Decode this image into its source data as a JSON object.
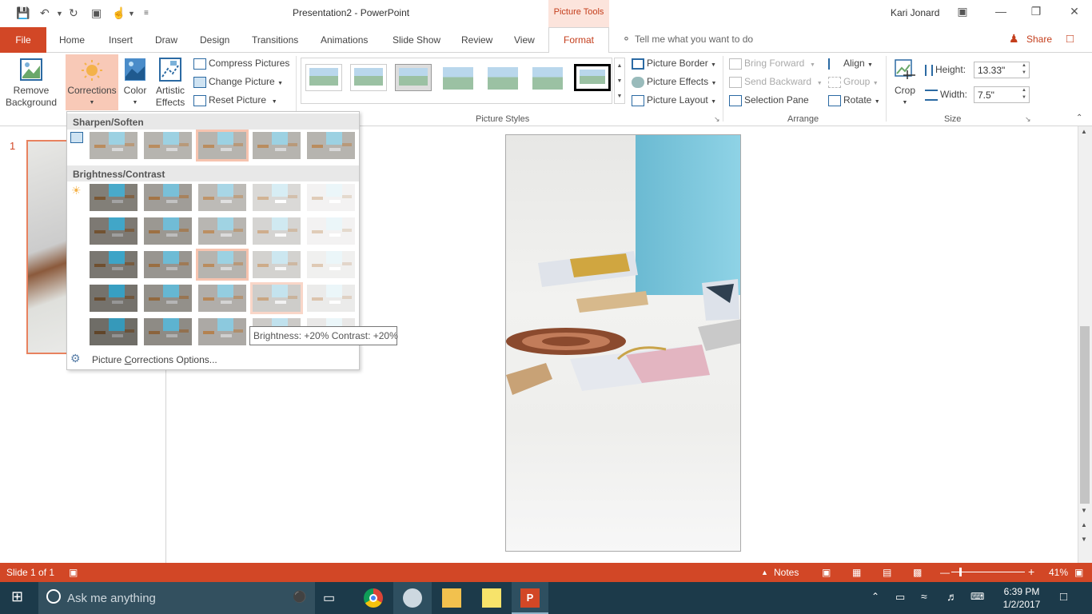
{
  "titlebar": {
    "doc_title": "Presentation2 - PowerPoint",
    "context_tab": "Picture Tools",
    "user": "Kari Jonard"
  },
  "tabs": {
    "file": "File",
    "items": [
      "Home",
      "Insert",
      "Draw",
      "Design",
      "Transitions",
      "Animations",
      "Slide Show",
      "Review",
      "View"
    ],
    "format": "Format",
    "tell_me": "Tell me what you want to do",
    "share": "Share"
  },
  "ribbon": {
    "adjust": {
      "remove_bg_1": "Remove",
      "remove_bg_2": "Background",
      "corrections": "Corrections",
      "color": "Color",
      "artistic_1": "Artistic",
      "artistic_2": "Effects",
      "compress": "Compress Pictures",
      "change": "Change Picture",
      "reset": "Reset Picture"
    },
    "picture_styles_label": "Picture Styles",
    "picture_border": "Picture Border",
    "picture_effects": "Picture Effects",
    "picture_layout": "Picture Layout",
    "arrange": {
      "bring_forward": "Bring Forward",
      "send_backward": "Send Backward",
      "selection_pane": "Selection Pane",
      "align": "Align",
      "group": "Group",
      "rotate": "Rotate",
      "label": "Arrange"
    },
    "size": {
      "crop": "Crop",
      "height_label": "Height:",
      "height_value": "13.33\"",
      "width_label": "Width:",
      "width_value": "7.5\"",
      "label": "Size"
    }
  },
  "dropdown": {
    "sharpen_header": "Sharpen/Soften",
    "brightness_header": "Brightness/Contrast",
    "options_prefix": "Picture ",
    "options_underlined": "C",
    "options_suffix": "orrections Options...",
    "tooltip": "Brightness: +20% Contrast: +20%"
  },
  "slides": {
    "current_number": "1"
  },
  "statusbar": {
    "slide_info": "Slide 1 of 1",
    "notes": "Notes",
    "zoom": "41%"
  },
  "taskbar": {
    "search_placeholder": "Ask me anything",
    "time": "6:39 PM",
    "date": "1/2/2017"
  }
}
